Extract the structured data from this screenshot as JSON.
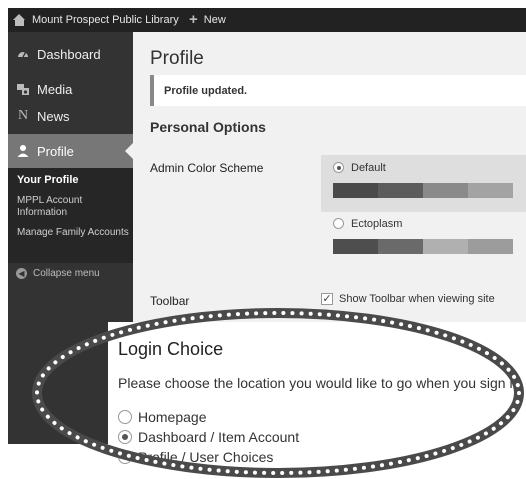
{
  "adminbar": {
    "site_name": "Mount Prospect Public Library",
    "site_icon": "house-icon",
    "new_label": "New",
    "new_icon": "plus-icon"
  },
  "sidebar": {
    "items": [
      {
        "label": "Dashboard",
        "icon": "dashboard-icon"
      },
      {
        "label": "Media",
        "icon": "media-icon"
      },
      {
        "label": "News",
        "icon": "news-icon"
      },
      {
        "label": "Profile",
        "icon": "user-icon",
        "active": true
      }
    ],
    "submenu": [
      {
        "label": "Your Profile",
        "current": true
      },
      {
        "label": "MPPL Account Information"
      },
      {
        "label": "Manage Family Accounts"
      }
    ],
    "collapse_label": "Collapse menu"
  },
  "main": {
    "title": "Profile",
    "notice": "Profile updated.",
    "section_heading": "Personal Options",
    "color_scheme": {
      "label": "Admin Color Scheme",
      "options": [
        {
          "name": "Default",
          "selected": true,
          "colors": [
            "#4a4a4a",
            "#5c5c5c",
            "#8a8a8a",
            "#a3a3a3"
          ]
        },
        {
          "name": "Ectoplasm",
          "selected": false,
          "colors": [
            "#4e4e4e",
            "#6a6a6a",
            "#b0b0b0",
            "#9c9c9c"
          ]
        }
      ]
    },
    "toolbar": {
      "label": "Toolbar",
      "checkbox_label": "Show Toolbar when viewing site",
      "checked": true
    }
  },
  "login_choice": {
    "title": "Login Choice",
    "description": "Please choose the location you would like to go when you sign in.",
    "options": [
      {
        "label": "Homepage",
        "selected": false
      },
      {
        "label": "Dashboard / Item Account",
        "selected": true
      },
      {
        "label": "Profile / User Choices",
        "selected": false
      }
    ]
  }
}
